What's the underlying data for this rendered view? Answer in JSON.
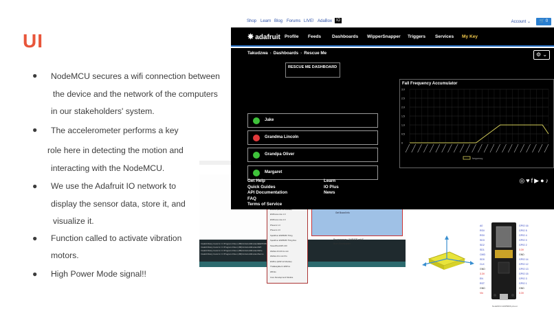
{
  "slide": {
    "title": "UI",
    "bullets": [
      [
        "NodeMCU  secures a wifi connection between",
        "the device and the network of the computers",
        "in our stakeholders' system."
      ],
      [
        "The accelerometer performs a key",
        "role here in detecting the motion and",
        "interacting with the NodeMCU."
      ],
      [
        "We use the Adafruit IO network to",
        "display the sensor data, store it, and",
        "visualize it."
      ],
      [
        "Function called to activate vibration",
        "motors."
      ],
      [
        "High Power Mode signal!!"
      ]
    ]
  },
  "adafruit": {
    "toplinks": [
      "Shop",
      "Learn",
      "Blog",
      "Forums",
      "LIVE!",
      "AdaBox",
      "IO"
    ],
    "account": "Account ⌄",
    "cart": "🛒 0",
    "logo": "adafruit",
    "nav": [
      "Profile",
      "Feeds",
      "Dashboards",
      "WipperSnapper",
      "Triggers",
      "Services",
      "My Key"
    ],
    "breadcrumb": [
      "Takudzwa",
      "Dashboards",
      "Rescue Me"
    ],
    "gear": "⚙ ⌄",
    "dashboard_block": "RESCUE ME DASHBOARD",
    "people": [
      {
        "name": "Jake",
        "status": "green"
      },
      {
        "name": "Grandma Lincoln",
        "status": "red"
      },
      {
        "name": "Grandpa Oliver",
        "status": "green"
      },
      {
        "name": "Margaret",
        "status": "green"
      }
    ],
    "colors": {
      "green": "#3ec23a",
      "red": "#e0393b",
      "accent": "#2a74c9",
      "line": "#d6cf5a"
    },
    "footer": {
      "col1": [
        "Get Help",
        "Quick Guides",
        "API Documentation",
        "FAQ",
        "Terms of Service"
      ],
      "col2": [
        "Learn",
        "IO Plus",
        "News"
      ]
    },
    "social_icons": [
      "instagram-icon",
      "twitter-icon",
      "facebook-icon",
      "youtube-icon",
      "github-icon",
      "tiktok-icon"
    ]
  },
  "chart_data": {
    "type": "line",
    "title": "Fall Frequency Accumulator",
    "ylim": [
      0,
      3.0
    ],
    "yticks": [
      "3.0",
      "2.5",
      "2.0",
      "1.5",
      "1.0",
      "0.5",
      "0"
    ],
    "series": [
      {
        "name": "frequency",
        "values": [
          0,
          0,
          0,
          0,
          0,
          0,
          0,
          0,
          0,
          0,
          0,
          0,
          0.25,
          0.5,
          0.75,
          1,
          1,
          1,
          1,
          1,
          1,
          1,
          1,
          0.5
        ]
      }
    ],
    "legend": "bottom"
  },
  "ide": {
    "menu_items": [
      "NodeMCU 1.0 (ESP-12E Module)",
      "NodeMCU 1.0 (ESP-12E Module)",
      "Olimex MOD-WIFI-ESP8266(-DEV)",
      "ESPino (ESP-12 Module)",
      "ESPresso Lite 1.0",
      "ESPresso Lite 2.0",
      "Phoenix 1.0",
      "Phoenix 2.0",
      "SparkFun ESP8266 Thing",
      "SparkFun ESP8266 Thing Dev",
      "SweetPea ESP-210",
      "WeMos D1 R2 & mini",
      "WeMos D1 mini Pro",
      "ESPino (ESP-12 Module)",
      "ThaiEasyElec's ESPino",
      "WifInfo",
      "Core Development Module"
    ],
    "selected_index": 0,
    "info_lines": [
      "CPU Frequency: \"80 MHz\"",
      "Flash Size: \"4M (3M SPIFFS)\"",
      "Upload Speed: \"115200\"",
      "Port: \"COM4\"",
      "Get Board Info"
    ],
    "programmer": [
      "Programmer: \"AVRISP mkII\"",
      "Burn Bootloader"
    ],
    "console_lines": [
      "Invalid library found in C:\\Program Files (x86)\\Arduino\\libraries\\EEPROM",
      "Invalid library found in C:\\Program Files (x86)\\Arduino\\libraries\\SPI",
      "Invalid library found in C:\\Program Files (x86)\\Arduino\\libraries\\Wire",
      "Invalid library found in C:\\Program Files (x86)\\Arduino\\libraries\\Servo"
    ]
  },
  "board": {
    "pins_left": [
      "A0",
      "RSV",
      "RSV",
      "SD3",
      "SD2",
      "SD1",
      "CMD",
      "SD0",
      "CLK",
      "GND",
      "3.3V",
      "EN",
      "RST",
      "GND",
      "Vin"
    ],
    "pins_right": [
      "GPIO 16",
      "GPIO 5",
      "GPIO 4",
      "GPIO 0",
      "GPIO 2",
      "3.3V",
      "GND",
      "GPIO 14",
      "GPIO 12",
      "GPIO 13",
      "GPIO 15",
      "GPIO 3",
      "GPIO 1",
      "GND",
      "3.3V"
    ],
    "caption": "NodeMCU ESP8266 pinout"
  }
}
